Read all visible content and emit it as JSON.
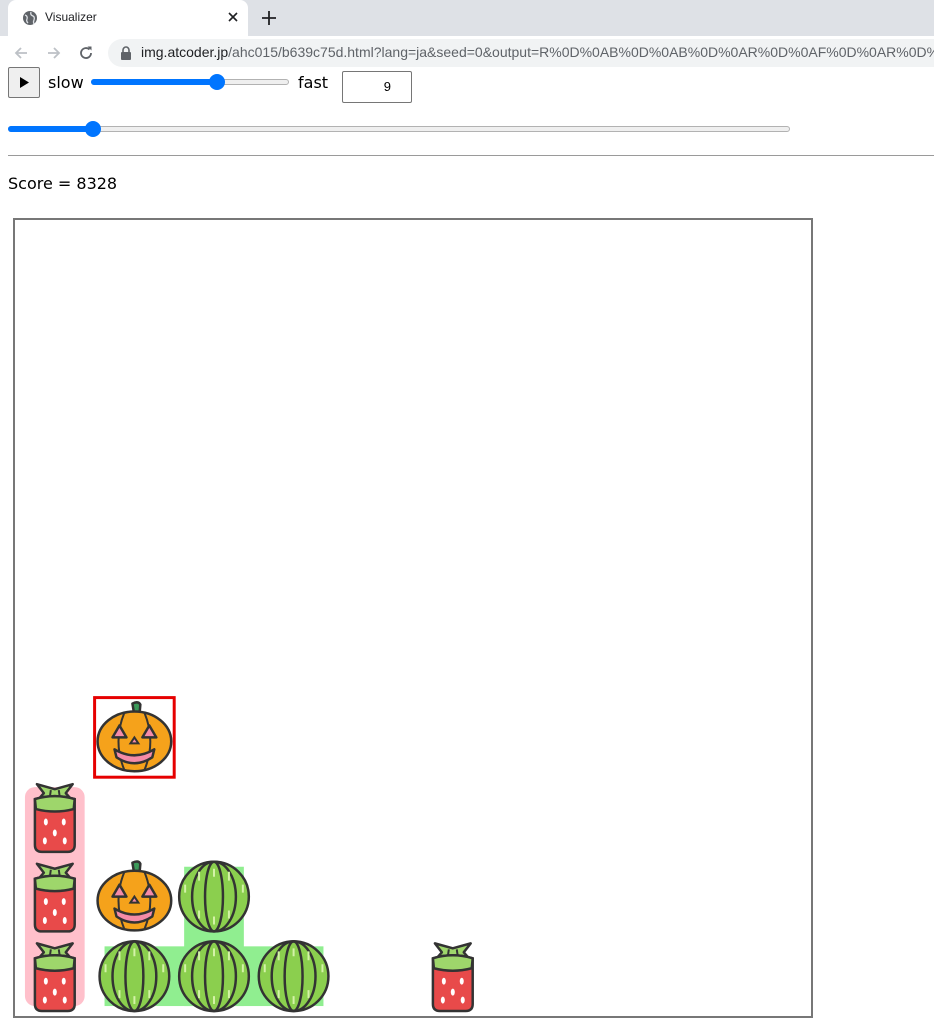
{
  "browser": {
    "tab_title": "Visualizer",
    "url_host": "img.atcoder.jp",
    "url_rest": "/ahc015/b639c75d.html?lang=ja&seed=0&output=R%0D%0AB%0D%0AB%0D%0AR%0D%0AF%0D%0AR%0D%0A"
  },
  "controls": {
    "play_icon": "play-icon",
    "slow_label": "slow",
    "fast_label": "fast",
    "speed_level": 0.65,
    "turn_value": "9",
    "turn_progress": 0.1
  },
  "score": {
    "text": "Score = 8328"
  },
  "board": {
    "grid_size": 10,
    "candies": [
      {
        "type": "strawberry",
        "row": 7,
        "col": 0
      },
      {
        "type": "strawberry",
        "row": 8,
        "col": 0
      },
      {
        "type": "strawberry",
        "row": 9,
        "col": 0
      },
      {
        "type": "pumpkin",
        "row": 8,
        "col": 1
      },
      {
        "type": "watermelon",
        "row": 9,
        "col": 1
      },
      {
        "type": "watermelon",
        "row": 8,
        "col": 2
      },
      {
        "type": "watermelon",
        "row": 9,
        "col": 2
      },
      {
        "type": "watermelon",
        "row": 9,
        "col": 3
      },
      {
        "type": "strawberry",
        "row": 9,
        "col": 5
      },
      {
        "type": "pumpkin",
        "row": 6,
        "col": 1,
        "highlighted": true
      }
    ],
    "colors": {
      "strawberry_group": "#ffc0cb",
      "watermelon_group": "#90ee90",
      "highlight": "#e60000"
    }
  }
}
